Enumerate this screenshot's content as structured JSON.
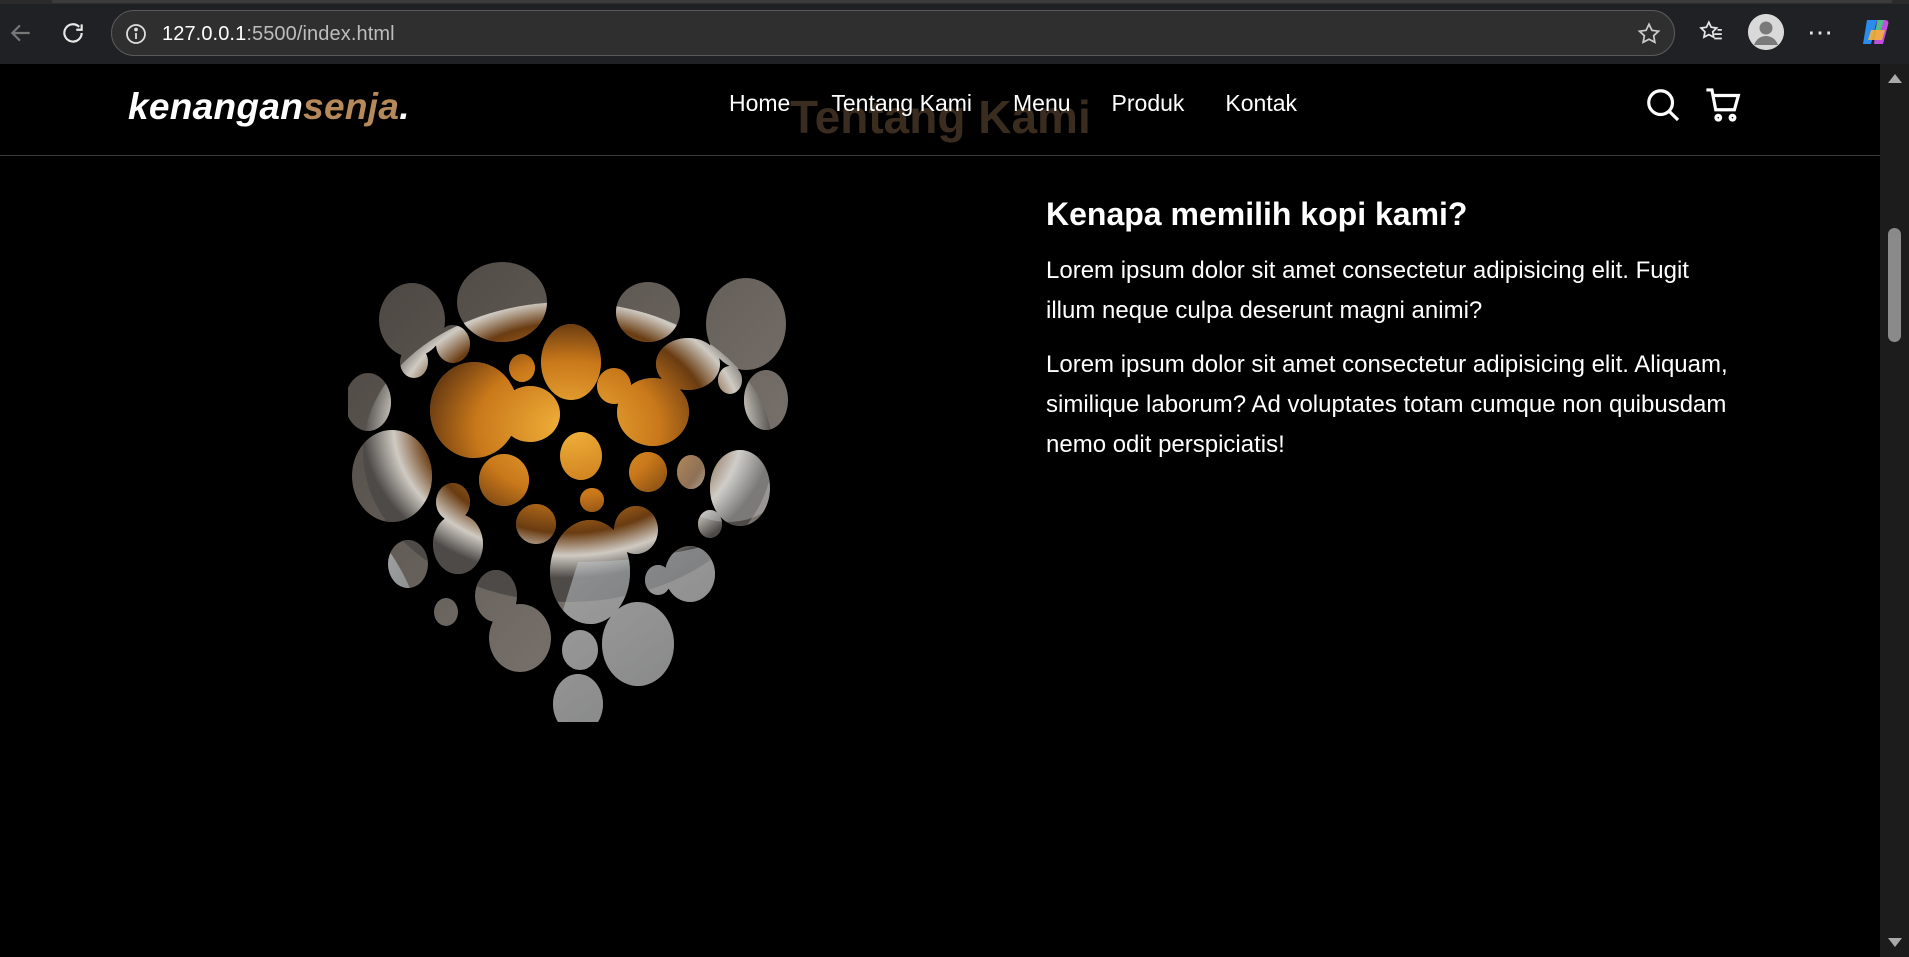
{
  "browser": {
    "url_host": "127.0.0.1",
    "url_rest": ":5500/index.html"
  },
  "site": {
    "logo_main": "kenangan",
    "logo_accent": "senja",
    "logo_dot": ".",
    "nav": [
      "Home",
      "Tentang Kami",
      "Menu",
      "Produk",
      "Kontak"
    ],
    "section_title": "Tentang Kami",
    "accent_color": "#b6895b"
  },
  "about": {
    "heading": "Kenapa memilih kopi kami?",
    "paragraph1": "Lorem ipsum dolor sit amet consectetur adipisicing elit. Fugit illum neque culpa deserunt magni animi?",
    "paragraph2": "Lorem ipsum dolor sit amet consectetur adipisicing elit. Aliquam, similique laborum? Ad voluptates totam cumque non quibusdam nemo odit perspiciatis!"
  },
  "icons": {
    "search": "search-icon",
    "cart": "shopping-cart-icon"
  }
}
